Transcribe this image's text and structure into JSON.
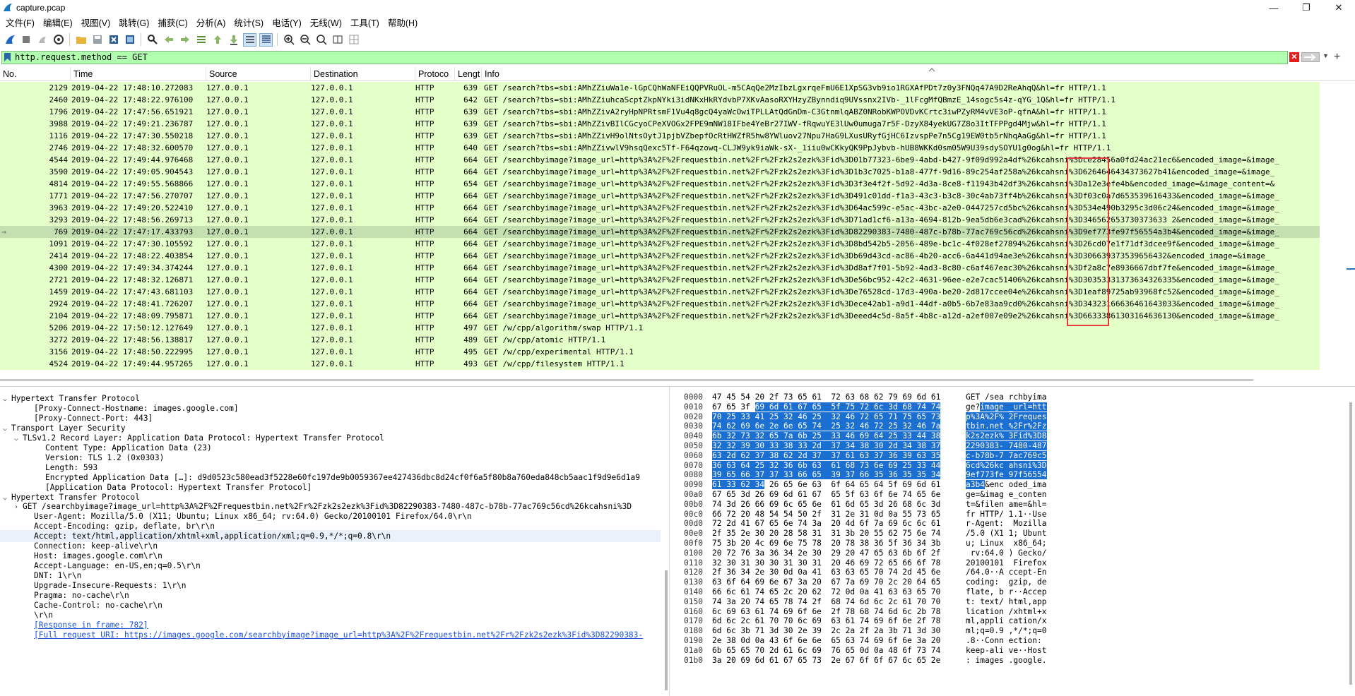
{
  "window": {
    "title": "capture.pcap"
  },
  "menu": [
    "文件(F)",
    "编辑(E)",
    "视图(V)",
    "跳转(G)",
    "捕获(C)",
    "分析(A)",
    "统计(S)",
    "电话(Y)",
    "无线(W)",
    "工具(T)",
    "帮助(H)"
  ],
  "toolbar_icons": [
    "shark-fin-start-icon",
    "stop-capture-icon",
    "restart-capture-icon",
    "capture-options-icon",
    "open-file-icon",
    "save-file-icon",
    "close-file-icon",
    "reload-file-icon",
    "find-packet-icon",
    "go-back-icon",
    "go-forward-icon",
    "go-to-packet-icon",
    "go-first-icon",
    "go-last-icon",
    "auto-scroll-icon",
    "colorize-icon",
    "zoom-in-icon",
    "zoom-out-icon",
    "zoom-normal-icon",
    "resize-columns-icon",
    "expand-all-icon"
  ],
  "filter": {
    "value": "http.request.method == GET"
  },
  "columns": [
    "No.",
    "Time",
    "Source",
    "Destination",
    "Protoco",
    "Lengt",
    "Info"
  ],
  "packets": [
    {
      "no": "2129",
      "time": "2019-04-22 17:48:10.272083",
      "src": "127.0.0.1",
      "dst": "127.0.0.1",
      "proto": "HTTP",
      "len": "639",
      "info": "GET /search?tbs=sbi:AMhZZiuWa1e-lGpCQhWaNFEiQQPVRuOL-m5CAqQe2MzIbzLgxrqeFmU6E1XpSG3vb9io1RGXAfPDt7z0y3FNQq47A9D2ReAhqQ&hl=fr HTTP/1.1"
    },
    {
      "no": "2460",
      "time": "2019-04-22 17:48:22.976100",
      "src": "127.0.0.1",
      "dst": "127.0.0.1",
      "proto": "HTTP",
      "len": "642",
      "info": "GET /search?tbs=sbi:AMhZZiuhcaScptZkpNYki3idNKxHkRYdvbP7XKvAasoRXYHzyZBynndiq9UVssnx2IVb-_1lFcgMfQBmzE_14sogc5s4z-qYG_1Q&hl=fr HTTP/1.1"
    },
    {
      "no": "1796",
      "time": "2019-04-22 17:47:56.651921",
      "src": "127.0.0.1",
      "dst": "127.0.0.1",
      "proto": "HTTP",
      "len": "639",
      "info": "GET /search?tbs=sbi:AMhZZivA2ryHpNPRtsmF1Vu4q8gcQ4yaWcOwiTPLLAtQdGnDm-C3GtnmlqABZ0NRobKWPOVDvKCrtc3iwPZyRM4vVE3oP-qfnA&hl=fr HTTP/1.1"
    },
    {
      "no": "3988",
      "time": "2019-04-22 17:49:21.236787",
      "src": "127.0.0.1",
      "dst": "127.0.0.1",
      "proto": "HTTP",
      "len": "639",
      "info": "GET /search?tbs=sbi:AMhZZivBIlCGcyoCPeXVOGx2FPE9mNW18IFbe4YeBr27IWV-fRqwuYE3lUw0umuga7r5F-DzyX84yekUG7Z8o3ItTFPPgd4Mjw&hl=fr HTTP/1.1"
    },
    {
      "no": "1116",
      "time": "2019-04-22 17:47:30.550218",
      "src": "127.0.0.1",
      "dst": "127.0.0.1",
      "proto": "HTTP",
      "len": "639",
      "info": "GET /search?tbs=sbi:AMhZZivH9olNtsOytJ1pjbVZbepfOcRtHWZfR5hw8YWluov27Npu7HaG9LXusURyfGjHC6IzvspPe7n5Cg19EW0tb5rNhqAaGg&hl=fr HTTP/1.1"
    },
    {
      "no": "2746",
      "time": "2019-04-22 17:48:32.600570",
      "src": "127.0.0.1",
      "dst": "127.0.0.1",
      "proto": "HTTP",
      "len": "640",
      "info": "GET /search?tbs=sbi:AMhZZivwlV9hsqQexc5Tf-F64qzowq-CLJW9yk9iaWk-sX-_1iiu0wCKkyQK9PpJybvb-hUB8WKKd0sm05W9U39sdySOYU1g0og&hl=fr HTTP/1.1"
    },
    {
      "no": "4544",
      "time": "2019-04-22 17:49:44.976468",
      "src": "127.0.0.1",
      "dst": "127.0.0.1",
      "proto": "HTTP",
      "len": "664",
      "info": "GET /searchbyimage?image_url=http%3A%2F%2Frequestbin.net%2Fr%2Fzk2s2ezk%3Fid%3D01b77323-6be9-4abd-b427-9f09d992a4df%26kcahsni%3Dce28456a0fd24ac21ec6&encoded_image=&image_"
    },
    {
      "no": "3590",
      "time": "2019-04-22 17:49:05.904543",
      "src": "127.0.0.1",
      "dst": "127.0.0.1",
      "proto": "HTTP",
      "len": "664",
      "info": "GET /searchbyimage?image_url=http%3A%2F%2Frequestbin.net%2Fr%2Fzk2s2ezk%3Fid%3D1b3c7025-b1a8-477f-9d16-89c254af258a%26kcahsni%3D6264646434373627b41&encoded_image=&image_"
    },
    {
      "no": "4814",
      "time": "2019-04-22 17:49:55.568866",
      "src": "127.0.0.1",
      "dst": "127.0.0.1",
      "proto": "HTTP",
      "len": "654",
      "info": "GET /searchbyimage?image_url=http%3A%2F%2Frequestbin.net%2Fr%2Fzk2s2ezk%3Fid%3D3f3e4f2f-5d92-4d3a-8ce8-f11943b42df3%26kcahsni%3Da12e3efe4b&encoded_image=&image_content=&"
    },
    {
      "no": "1771",
      "time": "2019-04-22 17:47:56.270707",
      "src": "127.0.0.1",
      "dst": "127.0.0.1",
      "proto": "HTTP",
      "len": "664",
      "info": "GET /searchbyimage?image_url=http%3A%2F%2Frequestbin.net%2Fr%2Fzk2s2ezk%3Fid%3D491c01dd-f1a3-43c3-b3c8-30c4ab73ff4b%26kcahsni%3Df03c0a7d653539616433&encoded_image=&image_"
    },
    {
      "no": "3963",
      "time": "2019-04-22 17:49:20.522410",
      "src": "127.0.0.1",
      "dst": "127.0.0.1",
      "proto": "HTTP",
      "len": "664",
      "info": "GET /searchbyimage?image_url=http%3A%2F%2Frequestbin.net%2Fr%2Fzk2s2ezk%3Fid%3D64ac599c-e5ac-43bc-a2e0-0447257cd5bc%26kcahsni%3D534e490b3295c3d06c24&encoded_image=&image_"
    },
    {
      "no": "3293",
      "time": "2019-04-22 17:48:56.269713",
      "src": "127.0.0.1",
      "dst": "127.0.0.1",
      "proto": "HTTP",
      "len": "664",
      "info": "GET /searchbyimage?image_url=http%3A%2F%2Frequestbin.net%2Fr%2Fzk2s2ezk%3Fid%3D71ad1cf6-a13a-4694-812b-9ea5db6e3cad%26kcahsni%3D346562653730373633 2&encoded_image=&image_"
    },
    {
      "no": "769",
      "time": "2019-04-22 17:47:17.433793",
      "src": "127.0.0.1",
      "dst": "127.0.0.1",
      "proto": "HTTP",
      "len": "664",
      "info": "GET /searchbyimage?image_url=http%3A%2F%2Frequestbin.net%2Fr%2Fzk2s2ezk%3Fid%3D82290383-7480-487c-b78b-77ac769c56cd%26kcahsni%3D9ef773fe97f56554a3b4&encoded_image=&image_",
      "selected": true
    },
    {
      "no": "1091",
      "time": "2019-04-22 17:47:30.105592",
      "src": "127.0.0.1",
      "dst": "127.0.0.1",
      "proto": "HTTP",
      "len": "664",
      "info": "GET /searchbyimage?image_url=http%3A%2F%2Frequestbin.net%2Fr%2Fzk2s2ezk%3Fid%3D8bd542b5-2056-489e-bc1c-4f028ef27894%26kcahsni%3D26cd07e1f71df3dcee9f&encoded_image=&image_"
    },
    {
      "no": "2414",
      "time": "2019-04-22 17:48:22.403854",
      "src": "127.0.0.1",
      "dst": "127.0.0.1",
      "proto": "HTTP",
      "len": "664",
      "info": "GET /searchbyimage?image_url=http%3A%2F%2Frequestbin.net%2Fr%2Fzk2s2ezk%3Fid%3Db69d43cd-ac86-4b20-acc6-6a441d94ae3e%26kcahsni%3D306639373539656432&encoded_image=&image_"
    },
    {
      "no": "4300",
      "time": "2019-04-22 17:49:34.374244",
      "src": "127.0.0.1",
      "dst": "127.0.0.1",
      "proto": "HTTP",
      "len": "664",
      "info": "GET /searchbyimage?image_url=http%3A%2F%2Frequestbin.net%2Fr%2Fzk2s2ezk%3Fid%3Dd8af7f01-5b92-4ad3-8c80-c6af467eac30%26kcahsni%3Df2a8c7e8936667dbf7fe&encoded_image=&image_"
    },
    {
      "no": "2721",
      "time": "2019-04-22 17:48:32.126871",
      "src": "127.0.0.1",
      "dst": "127.0.0.1",
      "proto": "HTTP",
      "len": "664",
      "info": "GET /searchbyimage?image_url=http%3A%2F%2Frequestbin.net%2Fr%2Fzk2s2ezk%3Fid%3De56bc952-42c2-4631-96ee-e2e7cac51406%26kcahsni%3D30353331373634326335&encoded_image=&image_"
    },
    {
      "no": "1459",
      "time": "2019-04-22 17:47:43.681103",
      "src": "127.0.0.1",
      "dst": "127.0.0.1",
      "proto": "HTTP",
      "len": "664",
      "info": "GET /searchbyimage?image_url=http%3A%2F%2Frequestbin.net%2Fr%2Fzk2s2ezk%3Fid%3De76528cd-17d3-490a-be20-2d817ccee04e%26kcahsni%3D1eaf89725ab93968fc52&encoded_image=&image_"
    },
    {
      "no": "2924",
      "time": "2019-04-22 17:48:41.726207",
      "src": "127.0.0.1",
      "dst": "127.0.0.1",
      "proto": "HTTP",
      "len": "664",
      "info": "GET /searchbyimage?image_url=http%3A%2F%2Frequestbin.net%2Fr%2Fzk2s2ezk%3Fid%3Dece42ab1-a9d1-44df-a0b5-6b7e83aa9cd0%26kcahsni%3D34323166636461643033&encoded_image=&image_"
    },
    {
      "no": "2104",
      "time": "2019-04-22 17:48:09.795871",
      "src": "127.0.0.1",
      "dst": "127.0.0.1",
      "proto": "HTTP",
      "len": "664",
      "info": "GET /searchbyimage?image_url=http%3A%2F%2Frequestbin.net%2Fr%2Fzk2s2ezk%3Fid%3Deeed4c5d-8a5f-4b8c-a12d-a2ef007e09e2%26kcahsni%3D66333861303164636130&encoded_image=&image_"
    },
    {
      "no": "5206",
      "time": "2019-04-22 17:50:12.127649",
      "src": "127.0.0.1",
      "dst": "127.0.0.1",
      "proto": "HTTP",
      "len": "497",
      "info": "GET /w/cpp/algorithm/swap HTTP/1.1"
    },
    {
      "no": "3272",
      "time": "2019-04-22 17:48:56.138817",
      "src": "127.0.0.1",
      "dst": "127.0.0.1",
      "proto": "HTTP",
      "len": "489",
      "info": "GET /w/cpp/atomic HTTP/1.1"
    },
    {
      "no": "3156",
      "time": "2019-04-22 17:48:50.222995",
      "src": "127.0.0.1",
      "dst": "127.0.0.1",
      "proto": "HTTP",
      "len": "495",
      "info": "GET /w/cpp/experimental HTTP/1.1"
    },
    {
      "no": "4524",
      "time": "2019-04-22 17:49:44.957265",
      "src": "127.0.0.1",
      "dst": "127.0.0.1",
      "proto": "HTTP",
      "len": "493",
      "info": "GET /w/cpp/filesystem HTTP/1.1"
    }
  ],
  "details": [
    {
      "indent": 0,
      "arrow": "v",
      "text": "Hypertext Transfer Protocol"
    },
    {
      "indent": 2,
      "arrow": "",
      "text": "[Proxy-Connect-Hostname: images.google.com]"
    },
    {
      "indent": 2,
      "arrow": "",
      "text": "[Proxy-Connect-Port: 443]"
    },
    {
      "indent": 0,
      "arrow": "v",
      "text": "Transport Layer Security"
    },
    {
      "indent": 1,
      "arrow": "v",
      "text": "TLSv1.2 Record Layer: Application Data Protocol: Hypertext Transfer Protocol"
    },
    {
      "indent": 3,
      "arrow": "",
      "text": "Content Type: Application Data (23)"
    },
    {
      "indent": 3,
      "arrow": "",
      "text": "Version: TLS 1.2 (0x0303)"
    },
    {
      "indent": 3,
      "arrow": "",
      "text": "Length: 593"
    },
    {
      "indent": 3,
      "arrow": "",
      "text": "Encrypted Application Data […]: d9d0523c580ead3f5228e60fc197de9b0059367ee427436dbc8d24cf0f6a5f80b8a760eda848cb5aac1f9d9e6d1a9"
    },
    {
      "indent": 3,
      "arrow": "",
      "text": "[Application Data Protocol: Hypertext Transfer Protocol]"
    },
    {
      "indent": 0,
      "arrow": "v",
      "text": "Hypertext Transfer Protocol"
    },
    {
      "indent": 1,
      "arrow": ">",
      "text": "GET /searchbyimage?image_url=http%3A%2F%2Frequestbin.net%2Fr%2Fzk2s2ezk%3Fid%3D82290383-7480-487c-b78b-77ac769c56cd%26kcahsni%3D"
    },
    {
      "indent": 2,
      "arrow": "",
      "text": "User-Agent: Mozilla/5.0 (X11; Ubuntu; Linux x86_64; rv:64.0) Gecko/20100101 Firefox/64.0\\r\\n"
    },
    {
      "indent": 2,
      "arrow": "",
      "text": "Accept-Encoding: gzip, deflate, br\\r\\n"
    },
    {
      "indent": 2,
      "arrow": "",
      "text": "Accept: text/html,application/xhtml+xml,application/xml;q=0.9,*/*;q=0.8\\r\\n",
      "highlight": true
    },
    {
      "indent": 2,
      "arrow": "",
      "text": "Connection: keep-alive\\r\\n"
    },
    {
      "indent": 2,
      "arrow": "",
      "text": "Host: images.google.com\\r\\n"
    },
    {
      "indent": 2,
      "arrow": "",
      "text": "Accept-Language: en-US,en;q=0.5\\r\\n"
    },
    {
      "indent": 2,
      "arrow": "",
      "text": "DNT: 1\\r\\n"
    },
    {
      "indent": 2,
      "arrow": "",
      "text": "Upgrade-Insecure-Requests: 1\\r\\n"
    },
    {
      "indent": 2,
      "arrow": "",
      "text": "Pragma: no-cache\\r\\n"
    },
    {
      "indent": 2,
      "arrow": "",
      "text": "Cache-Control: no-cache\\r\\n"
    },
    {
      "indent": 2,
      "arrow": "",
      "text": "\\r\\n"
    },
    {
      "indent": 2,
      "arrow": "",
      "text": "[Response in frame: 782]",
      "link": true
    },
    {
      "indent": 2,
      "arrow": "",
      "text": "[Full request URI: https://images.google.com/searchbyimage?image_url=http%3A%2F%2Frequestbin.net%2Fr%2Fzk2s2ezk%3Fid%3D82290383-",
      "link": true
    }
  ],
  "bytes": [
    {
      "off": "0000",
      "hex": [
        "47 45 54 20 2f 73 65 61  72 63 68 62 79 69 6d 61",
        ""
      ],
      "asc": [
        "GET /sea rchbyima",
        ""
      ]
    },
    {
      "off": "0010",
      "hex": [
        "67 65 3f ",
        "69 6d 61 67 65  5f 75 72 6c 3d 68 74 74"
      ],
      "asc": [
        "ge?",
        "image _url=htt"
      ]
    },
    {
      "off": "0020",
      "hex": [
        "",
        "70 25 33 41 25 32 46 25  32 46 72 65 71 75 65 73"
      ],
      "asc": [
        "",
        "p%3A%2F% 2Freques"
      ]
    },
    {
      "off": "0030",
      "hex": [
        "",
        "74 62 69 6e 2e 6e 65 74  25 32 46 72 25 32 46 7a"
      ],
      "asc": [
        "",
        "tbin.net %2Fr%2Fz"
      ]
    },
    {
      "off": "0040",
      "hex": [
        "",
        "6b 32 73 32 65 7a 6b 25  33 46 69 64 25 33 44 38"
      ],
      "asc": [
        "",
        "k2s2ezk% 3Fid%3D8"
      ]
    },
    {
      "off": "0050",
      "hex": [
        "",
        "32 32 39 30 33 38 33 2d  37 34 38 30 2d 34 38 37"
      ],
      "asc": [
        "",
        "2290383- 7480-487"
      ]
    },
    {
      "off": "0060",
      "hex": [
        "",
        "63 2d 62 37 38 62 2d 37  37 61 63 37 36 39 63 35"
      ],
      "asc": [
        "",
        "c-b78b-7 7ac769c5"
      ]
    },
    {
      "off": "0070",
      "hex": [
        "",
        "36 63 64 25 32 36 6b 63  61 68 73 6e 69 25 33 44"
      ],
      "asc": [
        "",
        "6cd%26kc ahsni%3D"
      ]
    },
    {
      "off": "0080",
      "hex": [
        "",
        "39 65 66 37 37 33 66 65  39 37 66 35 36 35 35 34"
      ],
      "asc": [
        "",
        "9ef773fe 97f56554"
      ]
    },
    {
      "off": "0090",
      "hex": [
        "",
        "61 33 62 34",
        " 26 65 6e 63  6f 64 65 64 5f 69 6d 61"
      ],
      "asc": [
        "",
        "a3b4",
        "&enc oded_ima"
      ]
    },
    {
      "off": "00a0",
      "hex": [
        "67 65 3d 26 69 6d 61 67  65 5f 63 6f 6e 74 65 6e",
        ""
      ],
      "asc": [
        "ge=&imag e_conten",
        ""
      ]
    },
    {
      "off": "00b0",
      "hex": [
        "74 3d 26 66 69 6c 65 6e  61 6d 65 3d 26 68 6c 3d",
        ""
      ],
      "asc": [
        "t=&filen ame=&hl=",
        ""
      ]
    },
    {
      "off": "00c0",
      "hex": [
        "66 72 20 48 54 54 50 2f  31 2e 31 0d 0a 55 73 65",
        ""
      ],
      "asc": [
        "fr HTTP/ 1.1··Use",
        ""
      ]
    },
    {
      "off": "00d0",
      "hex": [
        "72 2d 41 67 65 6e 74 3a  20 4d 6f 7a 69 6c 6c 61",
        ""
      ],
      "asc": [
        "r-Agent:  Mozilla",
        ""
      ]
    },
    {
      "off": "00e0",
      "hex": [
        "2f 35 2e 30 20 28 58 31  31 3b 20 55 62 75 6e 74",
        ""
      ],
      "asc": [
        "/5.0 (X1 1; Ubunt",
        ""
      ]
    },
    {
      "off": "00f0",
      "hex": [
        "75 3b 20 4c 69 6e 75 78  20 78 38 36 5f 36 34 3b",
        ""
      ],
      "asc": [
        "u; Linux  x86_64;",
        ""
      ]
    },
    {
      "off": "0100",
      "hex": [
        "20 72 76 3a 36 34 2e 30  29 20 47 65 63 6b 6f 2f",
        ""
      ],
      "asc": [
        " rv:64.0 ) Gecko/",
        ""
      ]
    },
    {
      "off": "0110",
      "hex": [
        "32 30 31 30 30 31 30 31  20 46 69 72 65 66 6f 78",
        ""
      ],
      "asc": [
        "20100101  Firefox",
        ""
      ]
    },
    {
      "off": "0120",
      "hex": [
        "2f 36 34 2e 30 0d 0a 41  63 63 65 70 74 2d 45 6e",
        ""
      ],
      "asc": [
        "/64.0··A ccept-En",
        ""
      ]
    },
    {
      "off": "0130",
      "hex": [
        "63 6f 64 69 6e 67 3a 20  67 7a 69 70 2c 20 64 65",
        ""
      ],
      "asc": [
        "coding:  gzip, de",
        ""
      ]
    },
    {
      "off": "0140",
      "hex": [
        "66 6c 61 74 65 2c 20 62  72 0d 0a 41 63 63 65 70",
        ""
      ],
      "asc": [
        "flate, b r··Accep",
        ""
      ]
    },
    {
      "off": "0150",
      "hex": [
        "74 3a 20 74 65 78 74 2f  68 74 6d 6c 2c 61 70 70",
        ""
      ],
      "asc": [
        "t: text/ html,app",
        ""
      ]
    },
    {
      "off": "0160",
      "hex": [
        "6c 69 63 61 74 69 6f 6e  2f 78 68 74 6d 6c 2b 78",
        ""
      ],
      "asc": [
        "lication /xhtml+x",
        ""
      ]
    },
    {
      "off": "0170",
      "hex": [
        "6d 6c 2c 61 70 70 6c 69  63 61 74 69 6f 6e 2f 78",
        ""
      ],
      "asc": [
        "ml,appli cation/x",
        ""
      ]
    },
    {
      "off": "0180",
      "hex": [
        "6d 6c 3b 71 3d 30 2e 39  2c 2a 2f 2a 3b 71 3d 30",
        ""
      ],
      "asc": [
        "ml;q=0.9 ,*/*;q=0",
        ""
      ]
    },
    {
      "off": "0190",
      "hex": [
        "2e 38 0d 0a 43 6f 6e 6e  65 63 74 69 6f 6e 3a 20",
        ""
      ],
      "asc": [
        ".8··Conn ection: ",
        ""
      ]
    },
    {
      "off": "01a0",
      "hex": [
        "6b 65 65 70 2d 61 6c 69  76 65 0d 0a 48 6f 73 74",
        ""
      ],
      "asc": [
        "keep-ali ve··Host",
        ""
      ]
    },
    {
      "off": "01b0",
      "hex": [
        "3a 20 69 6d 61 67 65 73  2e 67 6f 6f 67 6c 65 2e",
        ""
      ],
      "asc": [
        ": images .google.",
        ""
      ]
    }
  ],
  "colors": {
    "filter_ok": "#afffaf",
    "http_row": "#e4ffc7",
    "selected_row": "#c5e0b0",
    "byte_selection": "#1b6fd1",
    "annotation_box": "#e53b3b"
  }
}
